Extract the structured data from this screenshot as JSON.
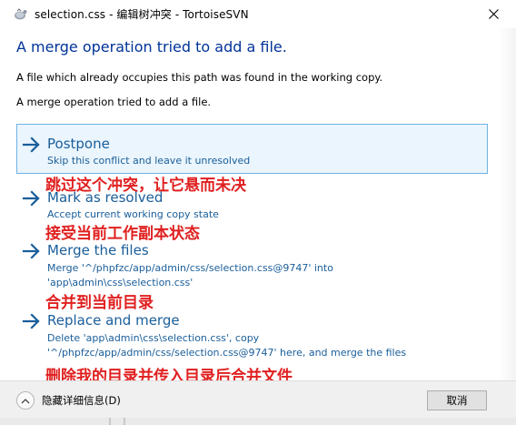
{
  "window": {
    "title": "selection.css - 编辑树冲突 - TortoiseSVN",
    "close_label": "✕"
  },
  "dialog": {
    "main_instruction": "A merge operation tried to add a file.",
    "content_line1": "A file which already occupies this path was found in the working copy.",
    "content_line2": "A merge operation tried to add a file."
  },
  "commands": [
    {
      "title": "Postpone",
      "desc": [
        "Skip this conflict and leave it unresolved"
      ],
      "annotation": "跳过这个冲突，让它悬而未决",
      "hovered": true
    },
    {
      "title": "Mark as resolved",
      "desc": [
        "Accept current working copy state"
      ],
      "annotation": "接受当前工作副本状态",
      "hovered": false
    },
    {
      "title": "Merge the files",
      "desc": [
        "Merge '^/phpfzc/app/admin/css/selection.css@9747' into",
        "'app\\admin\\css\\selection.css'"
      ],
      "annotation": "合并到当前目录",
      "hovered": false
    },
    {
      "title": "Replace and merge",
      "desc": [
        "Delete 'app\\admin\\css\\selection.css', copy",
        "'^/phpfzc/app/admin/css/selection.css@9747' here, and merge the files"
      ],
      "annotation": "删除我的目录并传入目录后合并文件",
      "hovered": false
    }
  ],
  "footer": {
    "details_label": "隐藏详细信息(D)",
    "cancel_label": "取消"
  },
  "colors": {
    "heading": "#003399",
    "link": "#1a5e9a",
    "annotation": "#e02020",
    "hover_border": "#6fb3e3",
    "hover_bg": "#eaf5fd"
  },
  "icons": {
    "app": "tortoisesvn-icon",
    "command": "arrow-right-icon",
    "expando": "chevron-up-icon"
  }
}
